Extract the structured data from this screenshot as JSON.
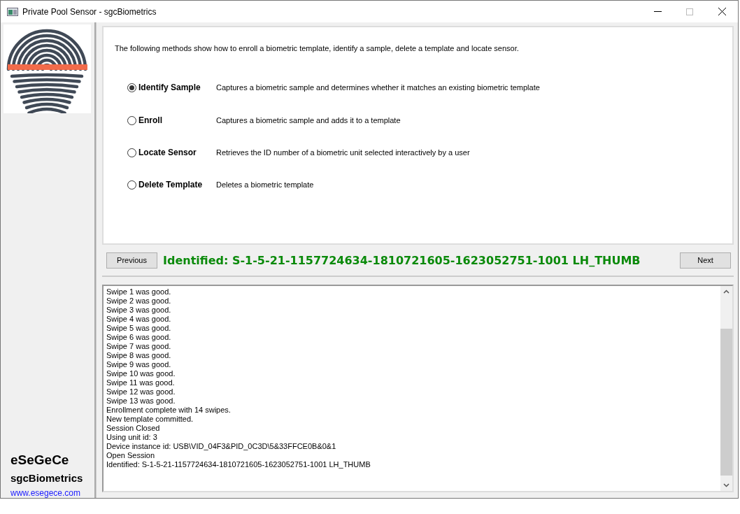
{
  "window": {
    "title": "Private Pool Sensor - sgcBiometrics"
  },
  "sidebar": {
    "company": "eSeGeCe",
    "product": "sgcBiometrics",
    "link": "www.esegece.com"
  },
  "intro": "The following methods show how to enroll a biometric template, identify a sample, delete a template and locate sensor.",
  "methods": [
    {
      "label": "Identify Sample",
      "description": "Captures a biometric sample and determines whether it matches an existing biometric template",
      "selected": true
    },
    {
      "label": "Enroll",
      "description": "Captures a biometric sample and adds it to a template",
      "selected": false
    },
    {
      "label": "Locate Sensor",
      "description": "Retrieves the ID number of a biometric unit selected interactively by a user",
      "selected": false
    },
    {
      "label": "Delete Template",
      "description": "Deletes a biometric template",
      "selected": false
    }
  ],
  "nav": {
    "previous": "Previous",
    "status": "Identified: S-1-5-21-1157724634-1810721605-1623052751-1001 LH_THUMB",
    "next": "Next"
  },
  "log": [
    "Swipe 1 was good.",
    "Swipe 2 was good.",
    "Swipe 3 was good.",
    "Swipe 4 was good.",
    "Swipe 5 was good.",
    "Swipe 6 was good.",
    "Swipe 7 was good.",
    "Swipe 8 was good.",
    "Swipe 9 was good.",
    "Swipe 10 was good.",
    "Swipe 11 was good.",
    "Swipe 12 was good.",
    "Swipe 13 was good.",
    "Enrollment complete with 14 swipes.",
    "New template committed.",
    "Session Closed",
    "Using unit id: 3",
    "Device instance id: USB\\VID_04F3&PID_0C3D\\5&33FFCE0B&0&1",
    "Open Session",
    "Identified: S-1-5-21-1157724634-1810721605-1623052751-1001 LH_THUMB"
  ]
}
